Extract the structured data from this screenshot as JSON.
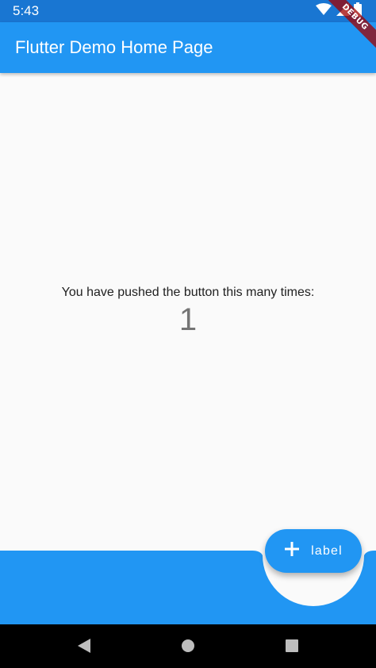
{
  "status_bar": {
    "time": "5:43",
    "background": "#1976d2",
    "icons": [
      "wifi-icon",
      "signal-icon",
      "battery-icon"
    ]
  },
  "debug_banner": {
    "label": "DEBUG"
  },
  "app_bar": {
    "title": "Flutter Demo Home Page",
    "background": "#2196f3"
  },
  "body": {
    "message": "You have pushed the button this many times:",
    "counter": "1"
  },
  "fab": {
    "icon": "plus-icon",
    "label": "label",
    "background": "#2196f3"
  },
  "bottom_app_bar": {
    "background": "#2196f3"
  },
  "navigation_bar": {
    "buttons": [
      "back-icon",
      "home-icon",
      "recents-icon"
    ]
  }
}
